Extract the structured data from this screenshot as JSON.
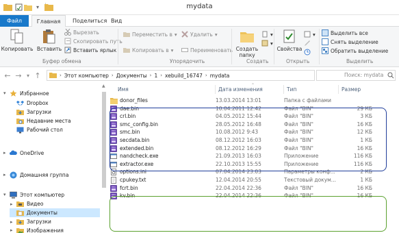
{
  "window": {
    "title": "mydata"
  },
  "ribbon": {
    "tabs": [
      "Файл",
      "Главная",
      "Поделиться",
      "Вид"
    ],
    "clipboard": {
      "copy": "Копировать",
      "paste": "Вставить",
      "cut": "Вырезать",
      "copy_path": "Скопировать путь",
      "paste_shortcut": "Вставить ярлык",
      "label": "Буфер обмена"
    },
    "organize": {
      "move_to": "Переместить в",
      "copy_to": "Копировать в",
      "delete": "Удалить",
      "rename": "Переименовать",
      "label": "Упорядочить"
    },
    "new": {
      "new_folder": "Создать папку",
      "label": "Создать"
    },
    "open": {
      "properties": "Свойства",
      "label": "Открыть"
    },
    "select": {
      "select_all": "Выделить все",
      "select_none": "Снять выделение",
      "invert": "Обратить выделение",
      "label": "Выделить"
    }
  },
  "address": {
    "crumbs": [
      "Этот компьютер",
      "Документы",
      "1",
      "xebuild_16747",
      "mydata"
    ],
    "search_placeholder": "Поиск: mydata"
  },
  "nav": {
    "favorites": "Избранное",
    "favorites_items": [
      "Dropbox",
      "Загрузки",
      "Недавние места",
      "Рабочий стол"
    ],
    "onedrive": "OneDrive",
    "homegroup": "Домашняя группа",
    "this_pc": "Этот компьютер",
    "pc_items": [
      "Видео",
      "Документы",
      "Загрузки",
      "Изображения"
    ]
  },
  "columns": {
    "name": "Имя",
    "date": "Дата изменения",
    "type": "Тип",
    "size": "Размер"
  },
  "files": [
    {
      "name": "donor_files",
      "date": "13.03.2014 13:01",
      "type": "Папка с файлами",
      "size": "",
      "icon": "folder-icon"
    },
    {
      "name": "dae.bin",
      "date": "10.04.2011 12:42",
      "type": "Файл \"BIN\"",
      "size": "29 КБ",
      "icon": "bin-file-icon"
    },
    {
      "name": "crl.bin",
      "date": "04.05.2012 15:44",
      "type": "Файл \"BIN\"",
      "size": "3 КБ",
      "icon": "bin-file-icon"
    },
    {
      "name": "smc_config.bin",
      "date": "28.05.2012 16:48",
      "type": "Файл \"BIN\"",
      "size": "16 КБ",
      "icon": "bin-file-icon"
    },
    {
      "name": "smc.bin",
      "date": "10.08.2012 9:43",
      "type": "Файл \"BIN\"",
      "size": "12 КБ",
      "icon": "bin-file-icon"
    },
    {
      "name": "secdata.bin",
      "date": "08.12.2012 16:03",
      "type": "Файл \"BIN\"",
      "size": "1 КБ",
      "icon": "bin-file-icon"
    },
    {
      "name": "extended.bin",
      "date": "08.12.2012 16:29",
      "type": "Файл \"BIN\"",
      "size": "16 КБ",
      "icon": "bin-file-icon"
    },
    {
      "name": "nandcheck.exe",
      "date": "21.09.2013 16:03",
      "type": "Приложение",
      "size": "116 КБ",
      "icon": "exe-icon"
    },
    {
      "name": "extractor.exe",
      "date": "22.10.2013 15:55",
      "type": "Приложение",
      "size": "116 КБ",
      "icon": "exe-icon"
    },
    {
      "name": "options.ini",
      "date": "07.04.2014 23:03",
      "type": "Параметры конф...",
      "size": "2 КБ",
      "icon": "ini-file-icon"
    },
    {
      "name": "cpukey.txt",
      "date": "12.04.2014 20:55",
      "type": "Текстовый докум...",
      "size": "1 КБ",
      "icon": "txt-file-icon"
    },
    {
      "name": "fcrt.bin",
      "date": "22.04.2014 22:36",
      "type": "Файл \"BIN\"",
      "size": "16 КБ",
      "icon": "bin-file-icon"
    },
    {
      "name": "kv.bin",
      "date": "22.04.2014 22:36",
      "type": "Файл \"BIN\"",
      "size": "16 КБ",
      "icon": "bin-file-icon"
    }
  ],
  "colors": {
    "file_tab": "#1979ca",
    "blue_highlight": "#1f3d9a",
    "green_highlight": "#5aa12e",
    "selected_nav": "#cce8ff"
  }
}
